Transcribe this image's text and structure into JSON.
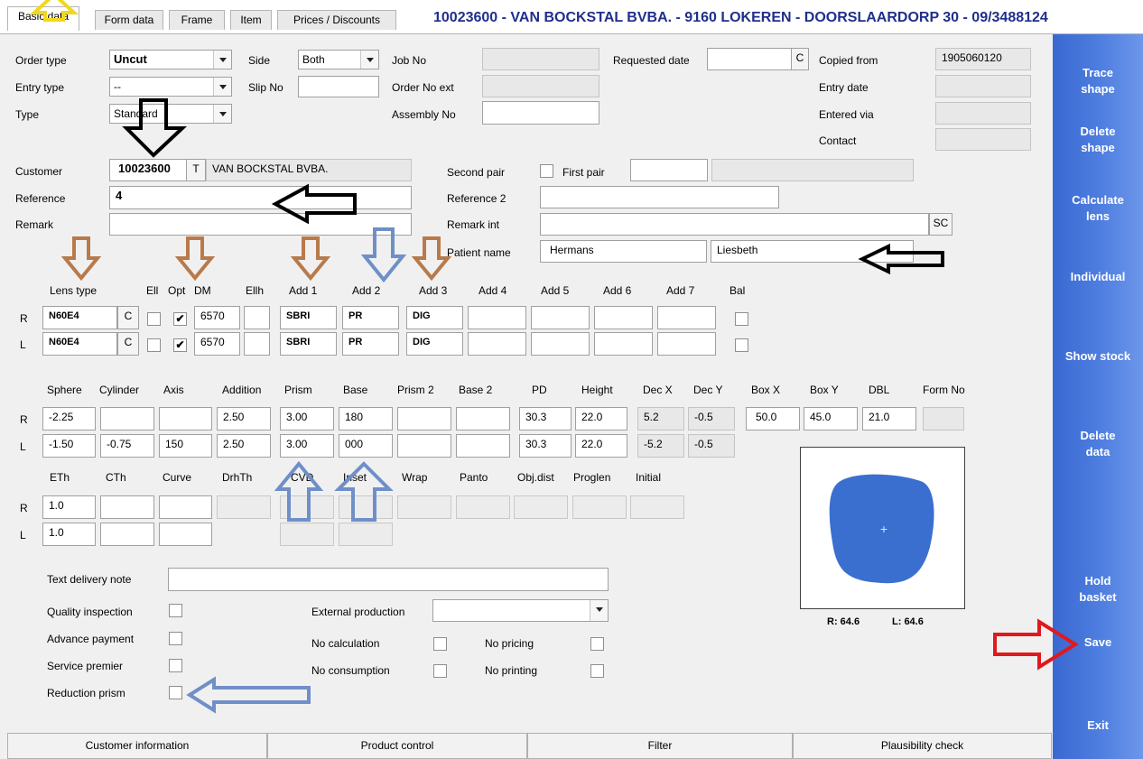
{
  "tabs": [
    "Basic data",
    "Form data",
    "Frame",
    "Item",
    "Prices / Discounts"
  ],
  "header_title": "10023600 - VAN BOCKSTAL BVBA. - 9160 LOKEREN - DOORSLAARDORP 30 - 09/3488124",
  "order": {
    "order_type_label": "Order type",
    "order_type_value": "Uncut",
    "entry_type_label": "Entry type",
    "entry_type_value": "--",
    "type_label": "Type",
    "type_value": "Standard",
    "side_label": "Side",
    "side_value": "Both",
    "slip_no_label": "Slip No",
    "slip_no_value": "",
    "job_no_label": "Job No",
    "job_no_value": "",
    "order_no_ext_label": "Order No ext",
    "order_no_ext_value": "",
    "assembly_no_label": "Assembly No",
    "assembly_no_value": "",
    "requested_date_label": "Requested date",
    "requested_date_value": "",
    "requested_date_btn": "C",
    "copied_from_label": "Copied from",
    "copied_from_value": "1905060120",
    "entry_date_label": "Entry date",
    "entry_date_value": "",
    "entered_via_label": "Entered via",
    "entered_via_value": "",
    "contact_label": "Contact",
    "contact_value": ""
  },
  "customer": {
    "customer_label": "Customer",
    "customer_no": "10023600",
    "customer_btn": "T",
    "customer_name": "VAN BOCKSTAL BVBA.",
    "reference_label": "Reference",
    "reference_value": "4",
    "remark_label": "Remark",
    "remark_value": "",
    "second_pair_label": "Second pair",
    "first_pair_label": "First pair",
    "first_pair_value": "",
    "first_pair_extra": "",
    "reference2_label": "Reference 2",
    "reference2_value": "",
    "remark_int_label": "Remark int",
    "remark_int_value": "",
    "remark_int_btn": "SC",
    "patient_name_label": "Patient name",
    "patient_last": "Hermans",
    "patient_first": "Liesbeth"
  },
  "lens": {
    "headers": [
      "Lens type",
      "Ell",
      "Opt",
      "DM",
      "Ellh",
      "Add 1",
      "Add 2",
      "Add 3",
      "Add 4",
      "Add 5",
      "Add 6",
      "Add 7",
      "Bal"
    ],
    "rows": [
      {
        "side": "R",
        "lens_type": "N60E4",
        "btn": "C",
        "opt_checked": "✔",
        "dm": "6570",
        "ellh": "",
        "add1": "SBRI",
        "add2": "PR",
        "add3": "DIG",
        "add4": "",
        "add5": "",
        "add6": "",
        "add7": ""
      },
      {
        "side": "L",
        "lens_type": "N60E4",
        "btn": "C",
        "opt_checked": "✔",
        "dm": "6570",
        "ellh": "",
        "add1": "SBRI",
        "add2": "PR",
        "add3": "DIG",
        "add4": "",
        "add5": "",
        "add6": "",
        "add7": ""
      }
    ]
  },
  "rx": {
    "headers": [
      "Sphere",
      "Cylinder",
      "Axis",
      "Addition",
      "Prism",
      "Base",
      "Prism 2",
      "Base 2",
      "PD",
      "Height",
      "Dec X",
      "Dec Y",
      "Box X",
      "Box Y",
      "DBL",
      "Form No"
    ],
    "rows": [
      {
        "side": "R",
        "sphere": "-2.25",
        "cylinder": "",
        "axis": "",
        "addition": "2.50",
        "prism": "3.00",
        "base": "180",
        "prism2": "",
        "base2": "",
        "pd": "30.3",
        "height": "22.0",
        "dec_x": "5.2",
        "dec_y": "-0.5",
        "box_x": "50.0",
        "box_y": "45.0",
        "dbl": "21.0",
        "form_no": ""
      },
      {
        "side": "L",
        "sphere": "-1.50",
        "cylinder": "-0.75",
        "axis": "150",
        "addition": "2.50",
        "prism": "3.00",
        "base": "000",
        "prism2": "",
        "base2": "",
        "pd": "30.3",
        "height": "22.0",
        "dec_x": "-5.2",
        "dec_y": "-0.5"
      }
    ]
  },
  "thickness": {
    "headers": [
      "ETh",
      "CTh",
      "Curve",
      "DrhTh",
      "CVD",
      "Inset",
      "Wrap",
      "Panto",
      "Obj.dist",
      "Proglen",
      "Initial"
    ],
    "rows": [
      {
        "side": "R",
        "eth": "1.0"
      },
      {
        "side": "L",
        "eth": "1.0"
      }
    ]
  },
  "options": {
    "text_delivery_note_label": "Text delivery note",
    "text_delivery_note_value": "",
    "quality_inspection_label": "Quality inspection",
    "advance_payment_label": "Advance payment",
    "service_premier_label": "Service premier",
    "reduction_prism_label": "Reduction prism",
    "external_production_label": "External production",
    "external_production_value": "",
    "no_calculation_label": "No calculation",
    "no_pricing_label": "No pricing",
    "no_consumption_label": "No consumption",
    "no_printing_label": "No printing"
  },
  "shape": {
    "plus": "+",
    "r_label": "R: 64.6",
    "l_label": "L: 64.6",
    "color": "#3a6fd0"
  },
  "sidebar": {
    "trace_shape": [
      "Trace",
      "shape"
    ],
    "delete_shape": [
      "Delete",
      "shape"
    ],
    "calculate_lens": [
      "Calculate",
      "lens"
    ],
    "individual": "Individual",
    "show_stock": "Show stock",
    "delete_data": [
      "Delete",
      "data"
    ],
    "hold_basket": [
      "Hold",
      "basket"
    ],
    "save": "Save",
    "exit": "Exit"
  },
  "bottom_tabs": [
    "Customer information",
    "Product control",
    "Filter",
    "Plausibility check"
  ],
  "colors": {
    "sidebar": "#4a78dc",
    "header_title": "#1f2f8c",
    "arrow_brown": "#b87a4b",
    "arrow_blue": "#6f8fc8",
    "arrow_black": "#000000",
    "arrow_red": "#e0191c",
    "arrow_yellow": "#f2d81b"
  }
}
